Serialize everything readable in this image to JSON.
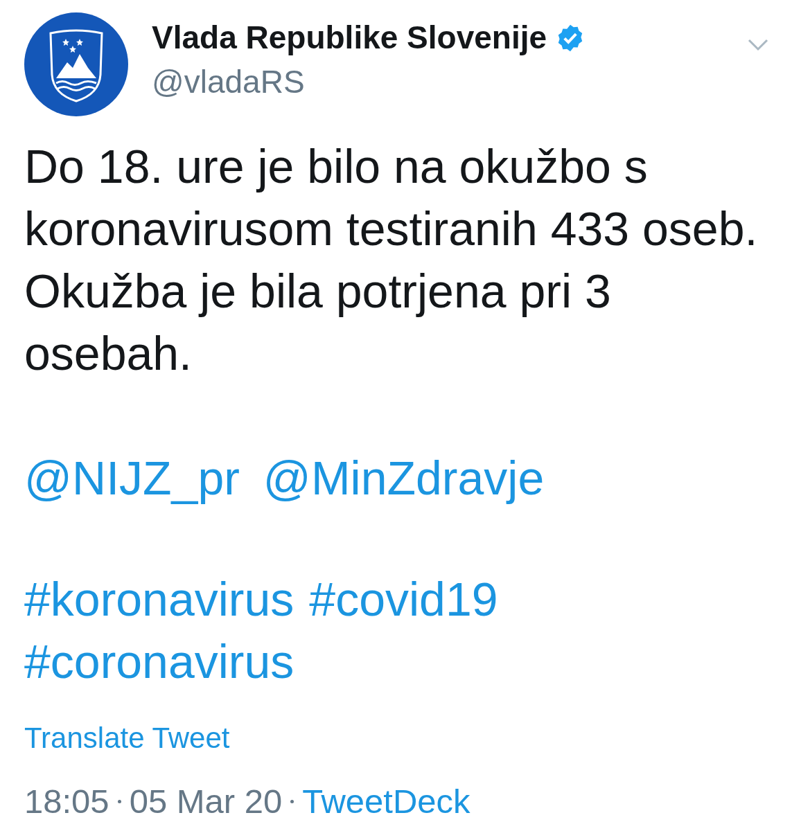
{
  "tweet": {
    "author_name": "Vlada Republike Slovenije",
    "verified": true,
    "handle": "@vladaRS",
    "text": "Do 18. ure je bilo na okužbo s koronavirusom testiranih 433 oseb. Okužba je bila potrjena pri 3 osebah.",
    "mentions": [
      "@NIJZ_pr",
      "@MinZdravje"
    ],
    "hashtags": [
      "#koronavirus",
      "#covid19",
      "#coronavirus"
    ],
    "translate_link": "Translate Tweet",
    "time": "18:05",
    "date": "05 Mar 20",
    "source": "TweetDeck"
  }
}
